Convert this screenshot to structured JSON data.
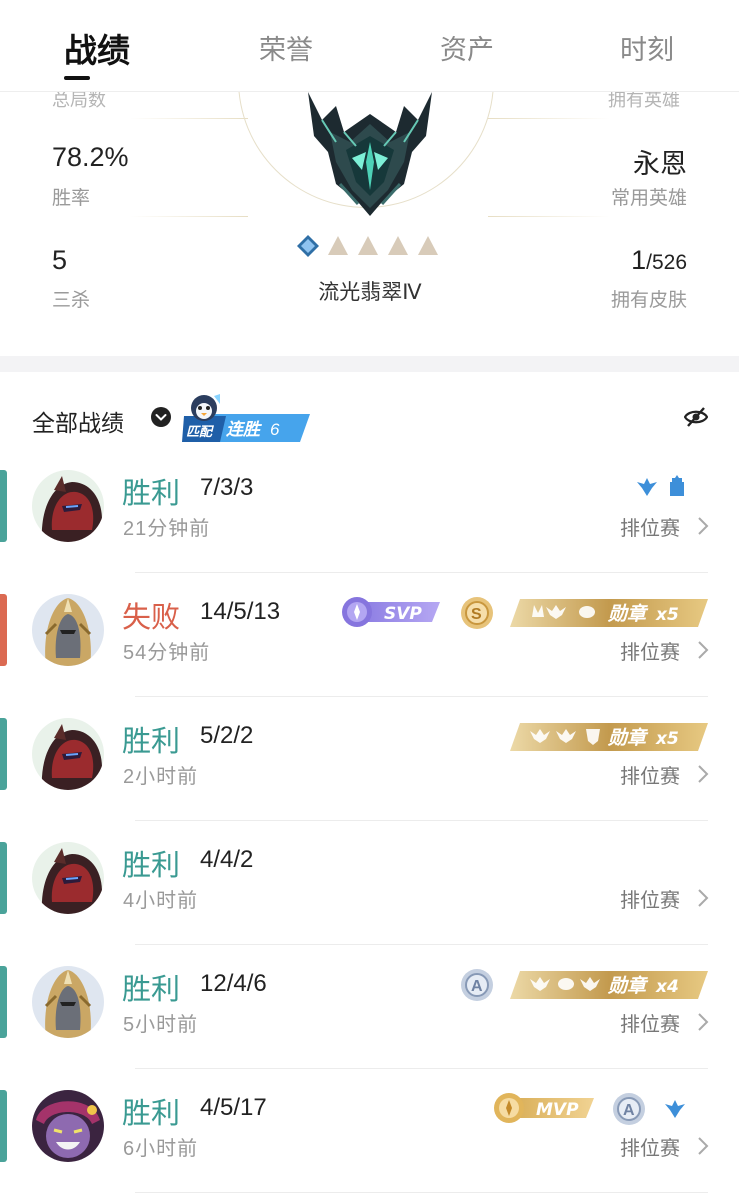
{
  "tabs": [
    {
      "label": "战绩",
      "active": true
    },
    {
      "label": "荣誉",
      "active": false
    },
    {
      "label": "资产",
      "active": false
    },
    {
      "label": "时刻",
      "active": false
    }
  ],
  "profile": {
    "left_stats": [
      {
        "value": "",
        "label": "总局数"
      },
      {
        "value": "78.2%",
        "label": "胜率"
      },
      {
        "value": "5",
        "label": "三杀"
      }
    ],
    "right_stats": [
      {
        "value": "",
        "label": "拥有英雄"
      },
      {
        "value": "永恩",
        "label": "常用英雄"
      },
      {
        "value_main": "1",
        "value_sub": "/526",
        "label": "拥有皮肤"
      }
    ],
    "rank_name": "流光翡翠Ⅳ",
    "rank_stars_filled": 1,
    "rank_stars_total": 5
  },
  "filter": {
    "label": "全部战绩",
    "streak_tag": "匹配",
    "streak_text": "连胜",
    "streak_count": "6"
  },
  "matches": [
    {
      "result": "胜利",
      "outcome": "win",
      "kda": "7/3/3",
      "time": "21分钟前",
      "mode": "排位赛",
      "avatar": "hero-red-demon",
      "badges": [
        "blue-emblem",
        "blue-tower"
      ]
    },
    {
      "result": "失败",
      "outcome": "loss",
      "kda": "14/5/13",
      "time": "54分钟前",
      "mode": "排位赛",
      "avatar": "hero-gold-armor",
      "badges": [
        "svp",
        "s-coin",
        "medal"
      ],
      "medal_label": "勋章",
      "medal_count": "x5",
      "badge_svp": "SVP",
      "badge_s": "S"
    },
    {
      "result": "胜利",
      "outcome": "win",
      "kda": "5/2/2",
      "time": "2小时前",
      "mode": "排位赛",
      "avatar": "hero-red-demon",
      "badges": [
        "medal"
      ],
      "medal_label": "勋章",
      "medal_count": "x5"
    },
    {
      "result": "胜利",
      "outcome": "win",
      "kda": "4/4/2",
      "time": "4小时前",
      "mode": "排位赛",
      "avatar": "hero-red-demon",
      "badges": []
    },
    {
      "result": "胜利",
      "outcome": "win",
      "kda": "12/4/6",
      "time": "5小时前",
      "mode": "排位赛",
      "avatar": "hero-gold-armor",
      "badges": [
        "a-coin",
        "medal"
      ],
      "medal_label": "勋章",
      "medal_count": "x4",
      "badge_a": "A"
    },
    {
      "result": "胜利",
      "outcome": "win",
      "kda": "4/5/17",
      "time": "6小时前",
      "mode": "排位赛",
      "avatar": "hero-purple-jester",
      "badges": [
        "mvp",
        "a-coin",
        "blue-emblem"
      ],
      "badge_mvp": "MVP",
      "badge_a": "A"
    }
  ],
  "colors": {
    "win": "#3a9a92",
    "loss": "#d9604a",
    "bar_win": "#4aa39a",
    "bar_loss": "#db6a52",
    "streak_blue": "#3f8fe0",
    "medal_gold": "#c9a25a"
  }
}
